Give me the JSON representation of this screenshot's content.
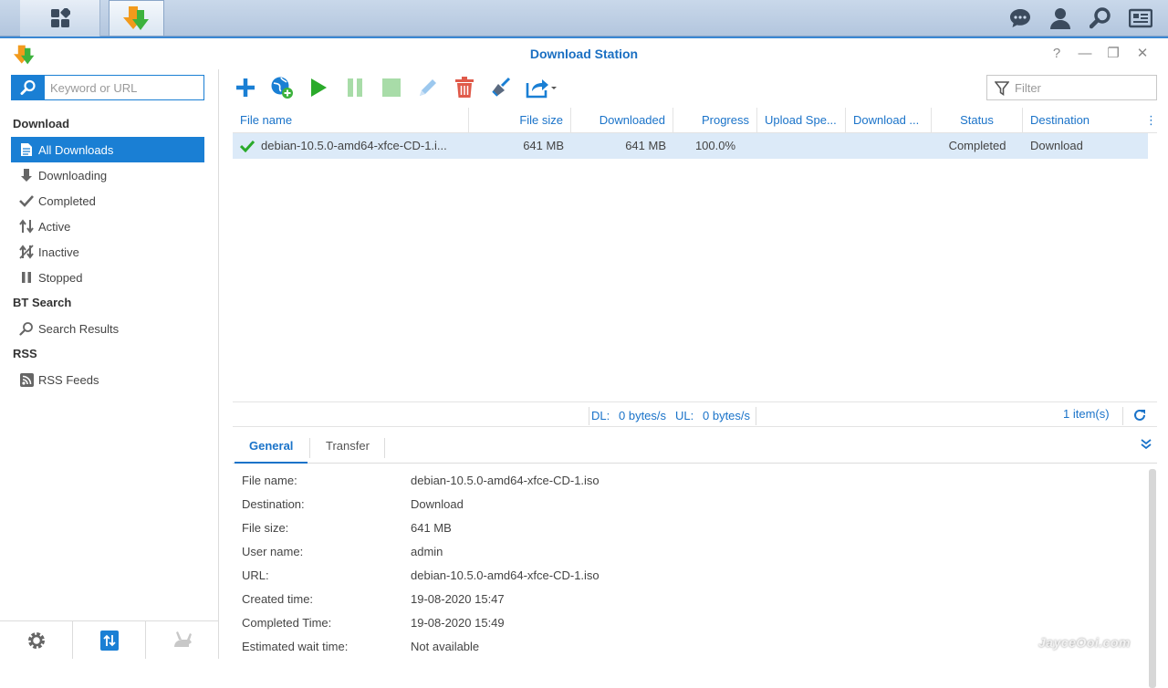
{
  "window": {
    "title": "Download Station",
    "help": "?",
    "minimize": "—",
    "restore": "❐",
    "close": "✕"
  },
  "sidebar": {
    "search_placeholder": "Keyword or URL",
    "sections": {
      "download": "Download",
      "bt_search": "BT Search",
      "rss": "RSS"
    },
    "items": [
      {
        "label": "All Downloads",
        "icon": "document-icon"
      },
      {
        "label": "Downloading",
        "icon": "arrow-down-icon"
      },
      {
        "label": "Completed",
        "icon": "check-icon"
      },
      {
        "label": "Active",
        "icon": "up-down-arrows-icon"
      },
      {
        "label": "Inactive",
        "icon": "inactive-icon"
      },
      {
        "label": "Stopped",
        "icon": "pause-icon"
      },
      {
        "label": "Search Results",
        "icon": "magnifier-icon"
      },
      {
        "label": "RSS Feeds",
        "icon": "rss-icon"
      }
    ]
  },
  "toolbar": {
    "filter_placeholder": "Filter"
  },
  "grid": {
    "columns": [
      "File name",
      "File size",
      "Downloaded",
      "Progress",
      "Upload Spe...",
      "Download ...",
      "Status",
      "Destination"
    ],
    "rows": [
      {
        "file_name": "debian-10.5.0-amd64-xfce-CD-1.i...",
        "file_size": "641 MB",
        "downloaded": "641 MB",
        "progress": "100.0%",
        "upload_speed": "",
        "download_speed": "",
        "status": "Completed",
        "destination": "Download"
      }
    ]
  },
  "status": {
    "dl_label": "DL:",
    "dl_value": "0 bytes/s",
    "ul_label": "UL:",
    "ul_value": "0 bytes/s",
    "count": "1 item(s)"
  },
  "detail": {
    "tabs": [
      "General",
      "Transfer"
    ],
    "fields": [
      {
        "key": "File name:",
        "value": "debian-10.5.0-amd64-xfce-CD-1.iso"
      },
      {
        "key": "Destination:",
        "value": "Download"
      },
      {
        "key": "File size:",
        "value": "641 MB"
      },
      {
        "key": "User name:",
        "value": "admin"
      },
      {
        "key": "URL:",
        "value": "debian-10.5.0-amd64-xfce-CD-1.iso"
      },
      {
        "key": "Created time:",
        "value": "19-08-2020 15:47"
      },
      {
        "key": "Completed Time:",
        "value": "19-08-2020 15:49"
      },
      {
        "key": "Estimated wait time:",
        "value": "Not available"
      }
    ]
  },
  "watermark": "JayceOoi.com",
  "colors": {
    "accent": "#1a7fd4",
    "selected_row": "#dceaf8",
    "play": "#2aaa2a",
    "delete": "#e05a4a"
  }
}
